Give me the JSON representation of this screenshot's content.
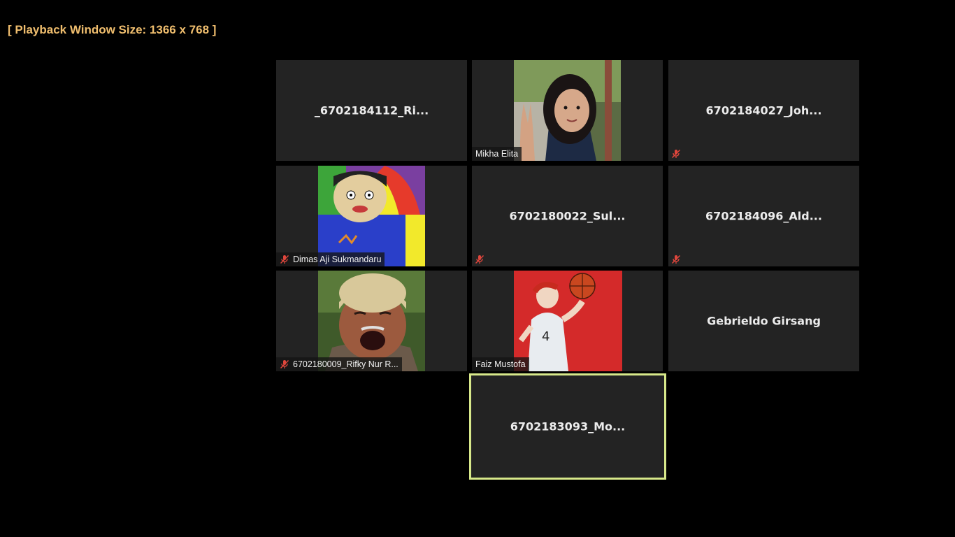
{
  "playback": {
    "label": "[ Playback Window Size: 1366 x 768 ]"
  },
  "participants": [
    {
      "name": "_6702184112_Ri...",
      "video": false,
      "muted": false
    },
    {
      "name": "Mikha Elita",
      "video": true,
      "muted": false
    },
    {
      "name": "6702184027_Joh...",
      "video": false,
      "muted": true
    },
    {
      "name": "Dimas Aji Sukmandaru",
      "video": true,
      "muted": true
    },
    {
      "name": "6702180022_Sul...",
      "video": false,
      "muted": true
    },
    {
      "name": "6702184096_Ald...",
      "video": false,
      "muted": true
    },
    {
      "name": "6702180009_Rifky Nur R...",
      "video": true,
      "muted": true
    },
    {
      "name": "Faiz Mustofa",
      "video": true,
      "muted": false
    },
    {
      "name": "Gebrieldo Girsang",
      "video": false,
      "muted": false
    }
  ],
  "active_speaker": {
    "name": "6702183093_Mo..."
  },
  "colors": {
    "label": "#f0be6e",
    "tile_bg": "#232323",
    "active_border": "#d7e88a",
    "mute_icon": "#e0463c"
  }
}
